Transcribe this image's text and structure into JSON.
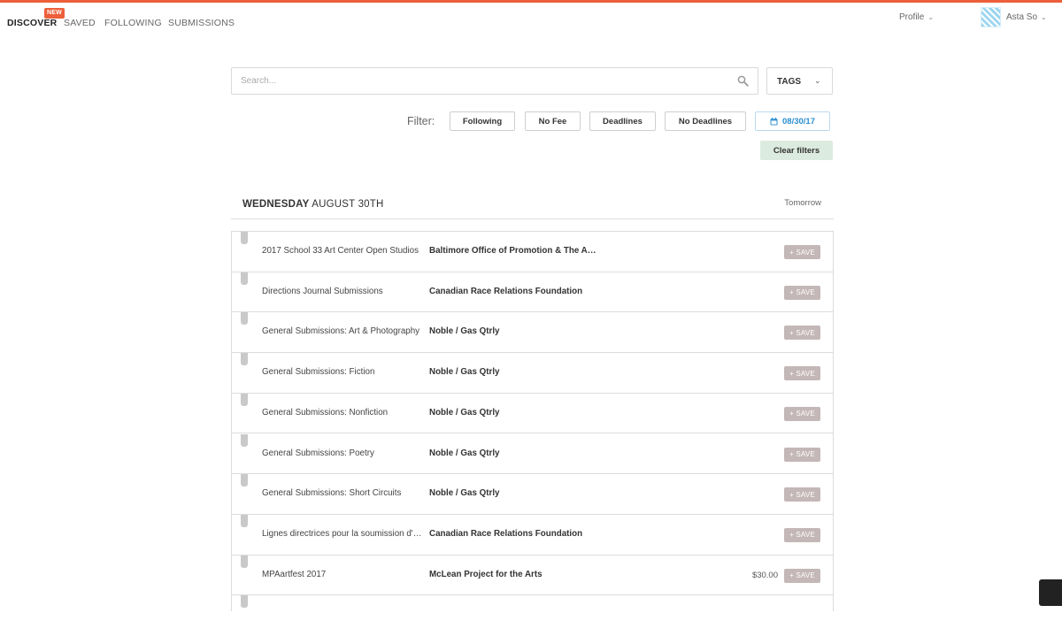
{
  "nav": {
    "items": [
      {
        "label": "DISCOVER",
        "active": true,
        "badge": "New"
      },
      {
        "label": "SAVED"
      },
      {
        "label": "FOLLOWING"
      },
      {
        "label": "SUBMISSIONS"
      }
    ],
    "profile_label": "Profile",
    "user_name": "Asta So"
  },
  "search": {
    "placeholder": "Search...",
    "value": ""
  },
  "tags": {
    "label": "TAGS"
  },
  "filters": {
    "label": "Filter:",
    "following": "Following",
    "no_fee": "No Fee",
    "deadlines": "Deadlines",
    "no_deadlines": "No Deadlines",
    "date": "08/30/17",
    "clear": "Clear filters"
  },
  "day": {
    "weekday": "WEDNESDAY",
    "date": "AUGUST 30TH",
    "relative": "Tomorrow"
  },
  "save_label": "+ SAVE",
  "rows": [
    {
      "title": "2017 School 33 Art Center Open Studios",
      "org": "Baltimore Office of Promotion & The Arts",
      "fee": ""
    },
    {
      "title": "Directions Journal Submissions",
      "org": "Canadian Race Relations Foundation",
      "fee": ""
    },
    {
      "title": "General Submissions: Art & Photography",
      "org": "Noble / Gas Qtrly",
      "fee": ""
    },
    {
      "title": "General Submissions: Fiction",
      "org": "Noble / Gas Qtrly",
      "fee": ""
    },
    {
      "title": "General Submissions: Nonfiction",
      "org": "Noble / Gas Qtrly",
      "fee": ""
    },
    {
      "title": "General Submissions: Poetry",
      "org": "Noble / Gas Qtrly",
      "fee": ""
    },
    {
      "title": "General Submissions: Short Circuits",
      "org": "Noble / Gas Qtrly",
      "fee": ""
    },
    {
      "title": "Lignes directrices pour la soumission d'articles",
      "org": "Canadian Race Relations Foundation",
      "fee": ""
    },
    {
      "title": "MPAartfest 2017",
      "org": "McLean Project for the Arts",
      "fee": "$30.00"
    }
  ],
  "colors": {
    "accent": "#ec5f3a",
    "date_blue": "#2a8fd1",
    "save_bg": "#c4b7b7",
    "clear_bg": "#dcebdf"
  }
}
